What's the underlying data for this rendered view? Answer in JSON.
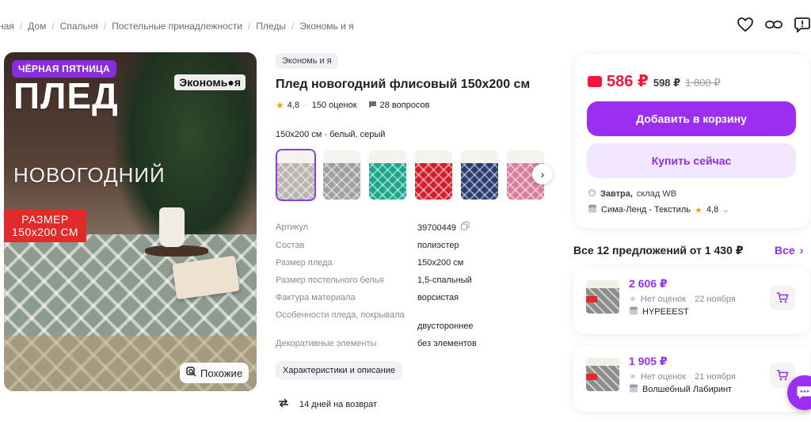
{
  "breadcrumb": {
    "items": [
      "ная",
      "Дом",
      "Спальня",
      "Постельные принадлежности",
      "Пледы",
      "Экономь и я"
    ]
  },
  "hero": {
    "badge": "ЧЁРНАЯ ПЯТНИЦА",
    "brand_logo": "Экономь●я",
    "title_big": "ПЛЕД",
    "title_sub": "НОВОГОДНИЙ",
    "size_line1": "РАЗМЕР",
    "size_line2": "150x200 СМ",
    "similar_label": "Похожие"
  },
  "product": {
    "brand": "Экономь и я",
    "title": "Плед новогодний флисовый 150х200 см",
    "rating": "4,8",
    "reviews": "150 оценок",
    "questions": "28 вопросов",
    "variant": "150х200 см · белый, серый",
    "thumb_colors": [
      "#b9b4b0",
      "#9d9fa1",
      "#1aa68a",
      "#d01f2a",
      "#2a3d6e",
      "#d97d9c"
    ],
    "specs": [
      {
        "k": "Артикул",
        "v": "39700449"
      },
      {
        "k": "Состав",
        "v": "полиэстер"
      },
      {
        "k": "Размер пледа",
        "v": "150х200 см"
      },
      {
        "k": "Размер постельного белья",
        "v": "1,5-спальный"
      },
      {
        "k": "Фактура материала",
        "v": "ворсистая"
      },
      {
        "k": "Особенности пледа, покрывала",
        "v": "двустороннее"
      },
      {
        "k": "Декоративные элементы",
        "v": "без элементов"
      }
    ],
    "char_button": "Характеристики и описание",
    "return_text": "14 дней на возврат"
  },
  "buy": {
    "price": "586 ₽",
    "price2": "598 ₽",
    "old_price": "1 800 ₽",
    "add_to_cart": "Добавить в корзину",
    "buy_now": "Купить сейчас",
    "delivery_day": "Завтра,",
    "delivery_place": "склад WB",
    "seller": "Сима-Ленд - Текстиль",
    "seller_rating": "4,8"
  },
  "offers": {
    "heading": "Все 12 предложений от 1 430 ₽",
    "all_label": "Все",
    "items": [
      {
        "price": "2 606 ₽",
        "rating": "Нет оценок",
        "date": "22 ноября",
        "seller": "HYPEEEST"
      },
      {
        "price": "1 905 ₽",
        "rating": "Нет оценок",
        "date": "21 ноября",
        "seller": "Волшебный Лабиринт"
      }
    ]
  },
  "colors": {
    "accent": "#9b2ef0",
    "price_red": "#f5143c",
    "star": "#ff9d00"
  }
}
